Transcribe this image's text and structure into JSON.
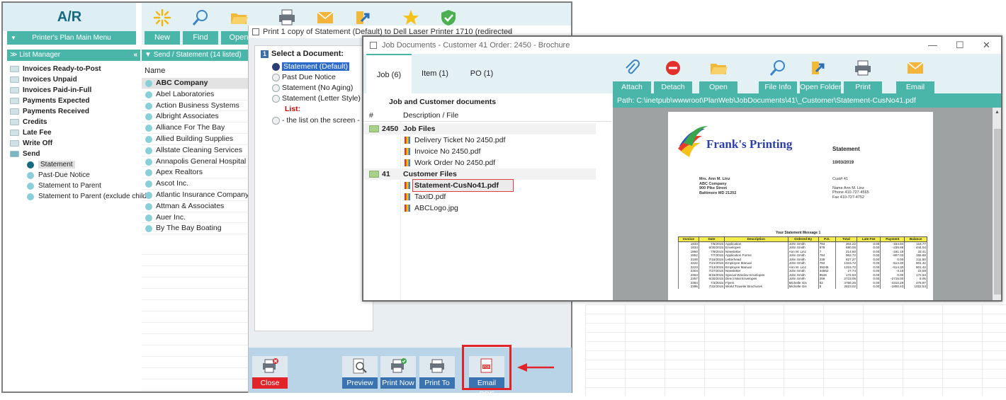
{
  "main": {
    "app_title": "A/R",
    "main_menu": "Printer's Plan Main Menu",
    "toolbar": [
      {
        "label": "New",
        "icon": "sparkle-icon"
      },
      {
        "label": "Find",
        "icon": "magnifier-icon"
      },
      {
        "label": "Open",
        "icon": "folder-open-icon"
      },
      {
        "label": "",
        "icon": "printer-icon"
      },
      {
        "label": "",
        "icon": "envelope-icon"
      },
      {
        "label": "",
        "icon": "folder-arrow-icon"
      },
      {
        "label": "",
        "icon": "star-icon"
      },
      {
        "label": "",
        "icon": "shield-check-icon"
      }
    ],
    "list_manager_header": "List Manager",
    "list_manager_collapse": "«",
    "list_manager_items": [
      "Invoices Ready-to-Post",
      "Invoices Unpaid",
      "Invoices Paid-in-Full",
      "Payments Expected",
      "Payments Received",
      "Credits",
      "Late Fee",
      "Write Off",
      "Send"
    ],
    "send_sub_items": [
      "Statement",
      "Past-Due Notice",
      "Statement to Parent",
      "Statement to Parent (exclude child"
    ],
    "send_header": "Send / Statement (14 listed)",
    "name_column_header": "Name",
    "customers": [
      "ABC Company",
      "Abel Laboratories",
      "Action Business Systems",
      "Albright Associates",
      "Alliance For The Bay",
      "Allied Building Supplies",
      "Allstate Cleaning Services",
      "Annapolis General Hospital",
      "Apex Realtors",
      "Ascot Inc.",
      "Atlantic Insurance Company",
      "Attman & Associates",
      "Auer Inc.",
      "By The Bay Boating"
    ]
  },
  "print_dialog": {
    "title": "Print 1 copy of Statement (Default) to Dell Laser Printer 1710 (redirected",
    "minimize": "—",
    "maximize": "☐",
    "close": "✕",
    "step_number": "1",
    "select_label": "Select a Document:",
    "options": [
      "Statement (Default)",
      "Past Due Notice",
      "Statement (No Aging)",
      "Statement (Letter Style)"
    ],
    "list_label": "List:",
    "list_item": "- the list on the screen -",
    "buttons": {
      "close": "Close",
      "preview": "Preview",
      "print_now": "Print Now",
      "print_to": "Print To",
      "email_pdf": "Email PDF"
    },
    "accent_red": "#e0242a"
  },
  "job_docs": {
    "title": "Job Documents - Customer 41 Order: 2450 - Brochure",
    "minimize": "—",
    "maximize": "☐",
    "close": "✕",
    "tabs": [
      "Job (6)",
      "Item (1)",
      "PO (1)"
    ],
    "toolbar": [
      {
        "label": "Attach",
        "icon": "paperclip-icon"
      },
      {
        "label": "Detach",
        "icon": "minus-circle-icon"
      },
      {
        "label": "Open",
        "icon": "folder-open-icon"
      },
      {
        "label": "File Info",
        "icon": "magnifier-icon"
      },
      {
        "label": "Open Folder",
        "icon": "folder-arrow-icon"
      },
      {
        "label": "Print",
        "icon": "printer-icon"
      },
      {
        "label": "Email",
        "icon": "envelope-icon"
      }
    ],
    "group_title": "Job and Customer documents",
    "col_num": "#",
    "col_desc": "Description / File",
    "groups": [
      {
        "num": "2450",
        "name": "Job Files",
        "files": [
          "Delivery Ticket No 2450.pdf",
          "Invoice No 2450.pdf",
          "Work Order No 2450.pdf"
        ]
      },
      {
        "num": "41",
        "name": "Customer Files",
        "files": [
          "Statement-CusNo41.pdf",
          "TaxID.pdf",
          "ABCLogo.jpg"
        ]
      }
    ],
    "path": "Path: C:\\inetpub\\wwwroot\\PlanWeb\\JobDocuments\\41\\_Customer\\Statement-CusNo41.pdf"
  },
  "statement": {
    "company": "Frank's Printing",
    "doc_title": "Statement",
    "date": "10/03/2019",
    "address_lines": [
      "Mrs. Ann M. Linz",
      "ABC Company",
      "900 Pike Street",
      "Baltimore MD 21202"
    ],
    "cust_lines": [
      "Cust#   41",
      "",
      "Name   Ann M. Linz",
      "Phone  410-727-4565",
      "Fax     410-727-4752"
    ],
    "message": "Your Statement Message 1",
    "columns": [
      "Invoice",
      "Date",
      "Description",
      "Ordered By",
      "P.O.",
      "Total",
      "Late Fee",
      "Payment",
      "Balance"
    ],
    "rows": [
      [
        "1933",
        "7/6/2015",
        "Application",
        "John Smith",
        "784",
        "304.22",
        "0.00",
        "-154.94",
        "116.77"
      ],
      [
        "1934",
        "6/30/2015",
        "Envelopes",
        "John Smith",
        "678",
        "680.06",
        "0.00",
        "-236.86",
        "444.04"
      ],
      [
        "1950",
        "7/9/2015",
        "Newsletter",
        "Ann M. Linz",
        "7",
        "214.60",
        "0.00",
        "-181.19",
        "33.41"
      ],
      [
        "1952",
        "7/7/2015",
        "Application Forms",
        "John Smith",
        "784",
        "962.72",
        "0.00",
        "-807.03",
        "155.69"
      ],
      [
        "2100",
        "7/15/2015",
        "Letterhead",
        "John Smith",
        "235",
        "827.27",
        "0.00",
        "0.00",
        "211.50"
      ],
      [
        "2222",
        "7/21/2015",
        "Employee Manual",
        "John Smith",
        "784",
        "1315.72",
        "0.00",
        "-514.30",
        "801.42"
      ],
      [
        "2223",
        "7/13/2015",
        "Employee Manual",
        "Ann M. Linz",
        "39245",
        "1315.72",
        "0.00",
        "-514.30",
        "801.42"
      ],
      [
        "2304",
        "7/27/2015",
        "Newsletter",
        "John Smith",
        "34562",
        "27.74",
        "0.00",
        "-4.15",
        "23.59"
      ],
      [
        "2354",
        "8/15/2015",
        "Special Window Envelopes",
        "John Smith",
        "8546",
        "172.53",
        "0.00",
        "0.00",
        "172.53"
      ],
      [
        "2357",
        "6/30/2015",
        "Direct Mail Envelopes",
        "John Smith",
        "259",
        "2723.05",
        "0.00",
        "-2715.00",
        "8.05"
      ],
      [
        "2364",
        "7/3/2015",
        "Flyers",
        "Michelle Gis",
        "52",
        "4786.26",
        "0.00",
        "-4310.29",
        "475.97"
      ],
      [
        "2396",
        "7/22/2015",
        "World Traveler Brochures",
        "Michelle Gis",
        "5",
        "2823.02",
        "0.00",
        "-1800.43",
        "1022.53"
      ]
    ]
  }
}
